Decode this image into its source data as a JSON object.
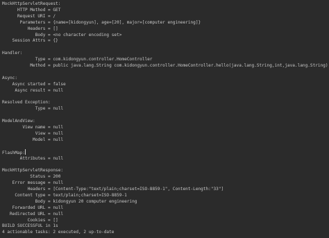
{
  "console": {
    "text_color": "#c8c8c8",
    "background_color": "#2b2b2b",
    "lines": [
      "MockHttpServletRequest:",
      "      HTTP Method = GET",
      "      Request URI = /",
      "       Parameters = {name=[kidongyun], age=[20], major=[computer engineering]}",
      "          Headers = []",
      "             Body = <no character encoding set>",
      "    Session Attrs = {}",
      "",
      "Handler:",
      "             Type = com.kidongyun.controller.HomeController",
      "           Method = public java.lang.String com.kidongyun.controller.HomeController.hello(java.lang.String,int,java.lang.String)",
      "",
      "Async:",
      "    Async started = false",
      "     Async result = null",
      "",
      "Resolved Exception:",
      "             Type = null",
      "",
      "ModelAndView:",
      "        View name = null",
      "             View = null",
      "            Model = null",
      "",
      "FlashMap:",
      "       Attributes = null",
      "",
      "MockHttpServletResponse:",
      "           Status = 200",
      "    Error message = null",
      "          Headers = [Content-Type:\"text/plain;charset=ISO-8859-1\", Content-Length:\"33\"]",
      "     Content type = text/plain;charset=ISO-8859-1",
      "             Body = kidongyun 20 computer engineering",
      "    Forwarded URL = null",
      "   Redirected URL = null",
      "          Cookies = []",
      "BUILD SUCCESSFUL in 1s",
      "4 actionable tasks: 2 executed, 2 up-to-date"
    ]
  }
}
